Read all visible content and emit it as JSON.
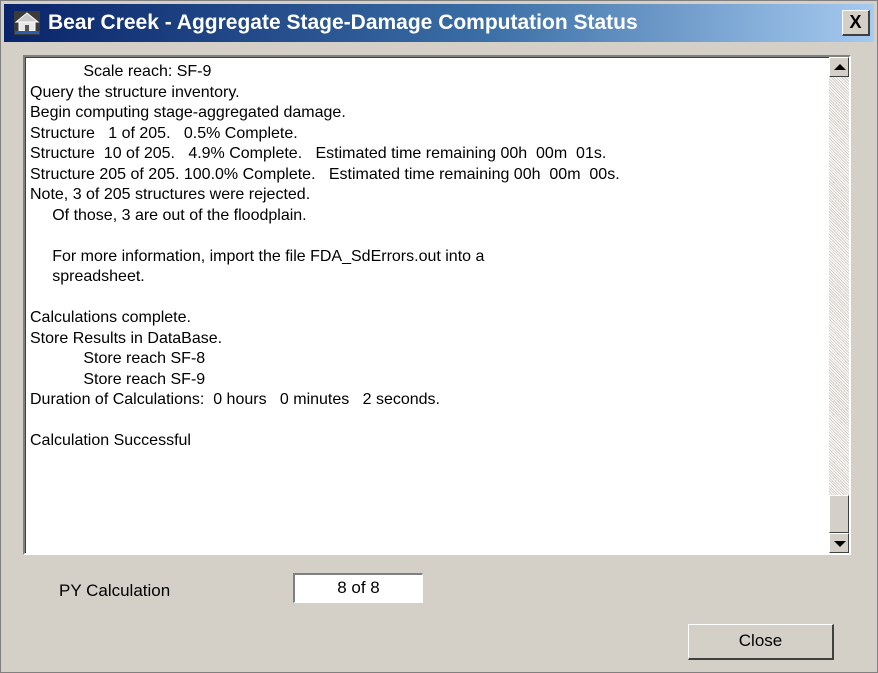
{
  "window": {
    "title": "Bear Creek - Aggregate Stage-Damage Computation Status",
    "close_glyph": "X",
    "app_icon": "house-icon"
  },
  "log": {
    "lines": [
      "            Scale reach: SF-9",
      "Query the structure inventory.",
      "Begin computing stage-aggregated damage.",
      "Structure   1 of 205.   0.5% Complete.",
      "Structure  10 of 205.   4.9% Complete.   Estimated time remaining 00h  00m  01s.",
      "Structure 205 of 205. 100.0% Complete.   Estimated time remaining 00h  00m  00s.",
      "Note, 3 of 205 structures were rejected.",
      "     Of those, 3 are out of the floodplain.",
      "",
      "     For more information, import the file FDA_SdErrors.out into a",
      "     spreadsheet.",
      "",
      "Calculations complete.",
      "Store Results in DataBase.",
      "            Store reach SF-8",
      "            Store reach SF-9",
      "Duration of Calculations:  0 hours   0 minutes   2 seconds.",
      "",
      "Calculation Successful"
    ]
  },
  "py_calculation": {
    "label": "PY Calculation",
    "value": "8 of 8"
  },
  "buttons": {
    "close_label": "Close"
  },
  "icons": {
    "scroll_up": "scroll-up-arrow-icon",
    "scroll_down": "scroll-down-arrow-icon"
  }
}
